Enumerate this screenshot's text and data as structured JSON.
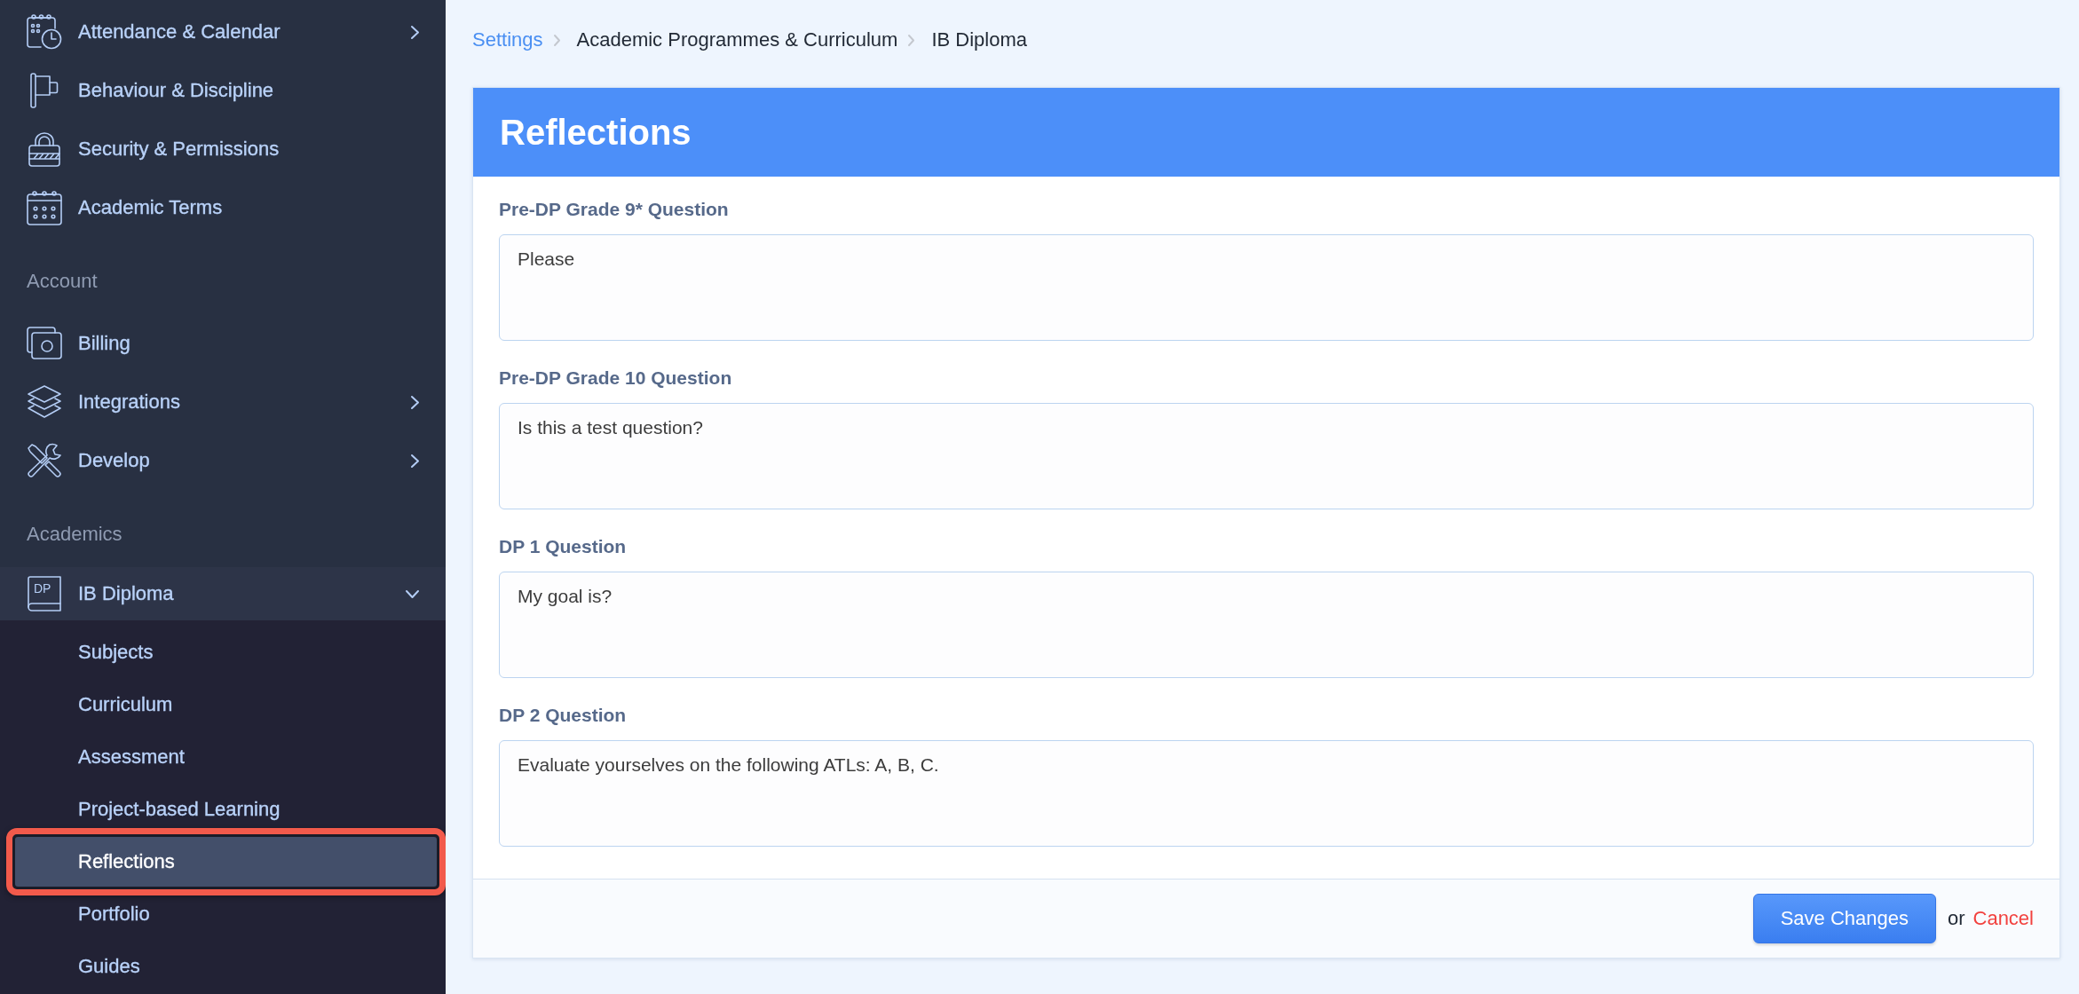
{
  "sidebar": {
    "sections": [
      {
        "items": [
          {
            "label": "Attendance & Calendar",
            "expanded": false
          },
          {
            "label": "Behaviour & Discipline"
          },
          {
            "label": "Security & Permissions"
          },
          {
            "label": "Academic Terms"
          }
        ]
      },
      {
        "heading": "Account",
        "items": [
          {
            "label": "Billing"
          },
          {
            "label": "Integrations",
            "expanded": false
          },
          {
            "label": "Develop",
            "expanded": false
          }
        ]
      },
      {
        "heading": "Academics",
        "items": [
          {
            "label": "IB Diploma",
            "icon_label": "DP",
            "expanded": true,
            "children": [
              {
                "label": "Subjects",
                "selected": false
              },
              {
                "label": "Curriculum",
                "selected": false
              },
              {
                "label": "Assessment",
                "selected": false
              },
              {
                "label": "Project-based Learning",
                "selected": false
              },
              {
                "label": "Reflections",
                "selected": true
              },
              {
                "label": "Portfolio",
                "selected": false
              },
              {
                "label": "Guides",
                "selected": false
              }
            ]
          }
        ]
      }
    ]
  },
  "breadcrumb": [
    {
      "label": "Settings",
      "kind": "link"
    },
    {
      "label": "Academic Programmes & Curriculum",
      "kind": "crumb"
    },
    {
      "label": "IB Diploma",
      "kind": "crumb"
    }
  ],
  "panel": {
    "title": "Reflections",
    "fields": [
      {
        "label": "Pre-DP Grade 9* Question",
        "value": "Please"
      },
      {
        "label": "Pre-DP Grade 10 Question",
        "value": "Is this a test question?"
      },
      {
        "label": "DP 1 Question",
        "value": "My goal is?"
      },
      {
        "label": "DP 2 Question",
        "value": "Evaluate yourselves on the following ATLs: A, B, C."
      }
    ],
    "footer": {
      "save_button": "Save Changes",
      "separator": "or",
      "cancel_link": "Cancel"
    }
  }
}
